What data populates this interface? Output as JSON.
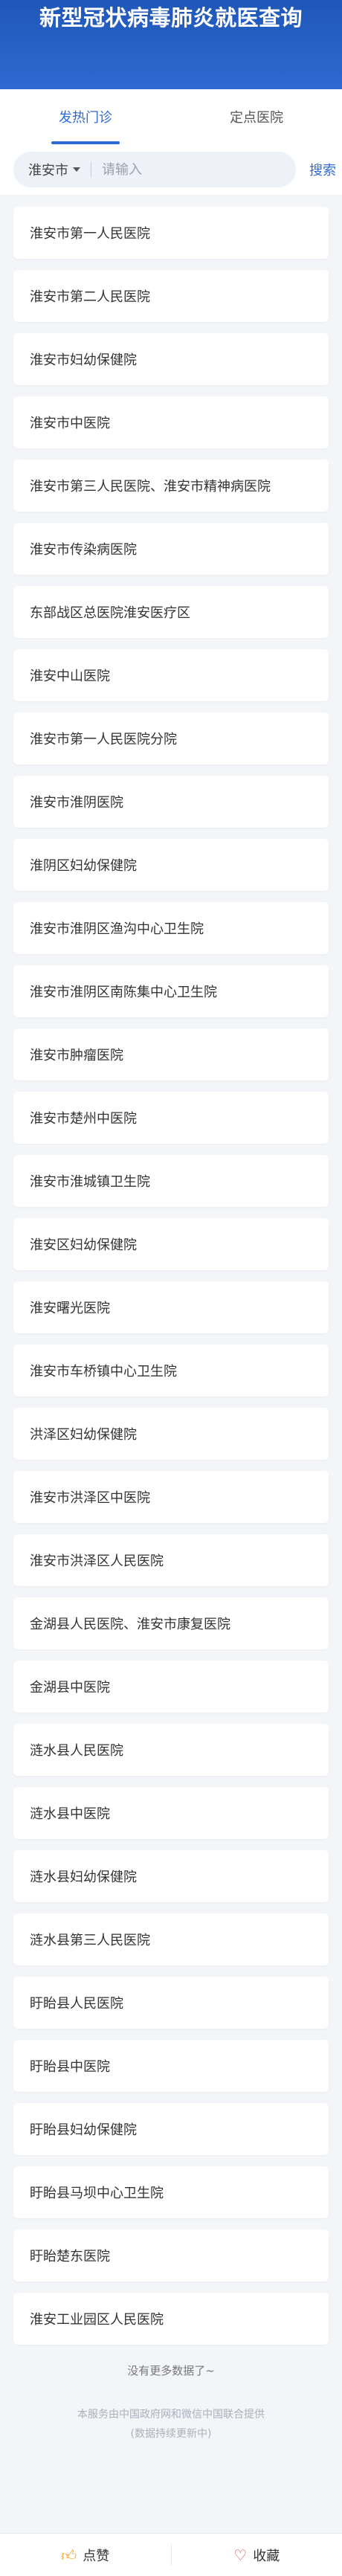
{
  "header": {
    "title": "新型冠状病毒肺炎就医查询"
  },
  "tabs": [
    {
      "label": "发热门诊"
    },
    {
      "label": "定点医院"
    }
  ],
  "search": {
    "city": "淮安市",
    "placeholder": "请输入",
    "button_label": "搜索"
  },
  "hospitals": [
    "淮安市第一人民医院",
    "淮安市第二人民医院",
    "淮安市妇幼保健院",
    "淮安市中医院",
    "淮安市第三人民医院、淮安市精神病医院",
    "淮安市传染病医院",
    "东部战区总医院淮安医疗区",
    "淮安中山医院",
    "淮安市第一人民医院分院",
    "淮安市淮阴医院",
    "淮阴区妇幼保健院",
    "淮安市淮阴区渔沟中心卫生院",
    "淮安市淮阴区南陈集中心卫生院",
    "淮安市肿瘤医院",
    "淮安市楚州中医院",
    "淮安市淮城镇卫生院",
    "淮安区妇幼保健院",
    "淮安曙光医院",
    "淮安市车桥镇中心卫生院",
    "洪泽区妇幼保健院",
    "淮安市洪泽区中医院",
    "淮安市洪泽区人民医院",
    "金湖县人民医院、淮安市康复医院",
    "金湖县中医院",
    "涟水县人民医院",
    "涟水县中医院",
    "涟水县妇幼保健院",
    "涟水县第三人民医院",
    "盱眙县人民医院",
    "盱眙县中医院",
    "盱眙县妇幼保健院",
    "盱眙县马坝中心卫生院",
    "盱眙楚东医院",
    "淮安工业园区人民医院"
  ],
  "list_end_text": "没有更多数据了~",
  "footer": {
    "line1": "本服务由中国政府网和微信中国联合提供",
    "line2": "(数据持续更新中)"
  },
  "bottom_bar": {
    "like_label": "点赞",
    "like_icon": "thumbs-up-icon",
    "favorite_label": "收藏",
    "favorite_icon": "heart-icon"
  }
}
